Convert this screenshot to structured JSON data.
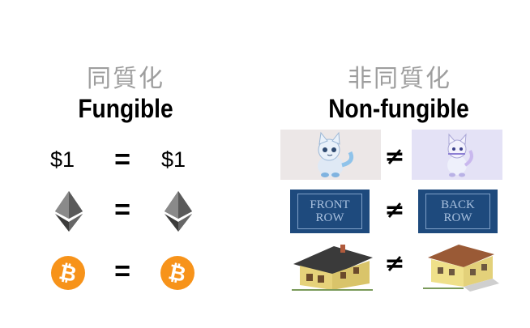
{
  "fungible": {
    "heading_cjk": "同質化",
    "title": "Fungible",
    "rows": [
      {
        "left": "$1",
        "op": "=",
        "right": "$1"
      },
      {
        "left_icon": "ethereum-icon",
        "op": "=",
        "right_icon": "ethereum-icon"
      },
      {
        "left_icon": "bitcoin-icon",
        "left_symbol": "₿",
        "op": "=",
        "right_icon": "bitcoin-icon",
        "right_symbol": "₿"
      }
    ]
  },
  "non_fungible": {
    "heading_cjk": "非同質化",
    "title": "Non-fungible",
    "rows": [
      {
        "left_icon": "cryptokitty-cat-image",
        "op": "≠",
        "right_icon": "cryptokitty-cat-image"
      },
      {
        "left_line1": "FRONT",
        "left_line2": "ROW",
        "op": "≠",
        "right_line1": "BACK",
        "right_line2": "ROW"
      },
      {
        "left_icon": "house-image",
        "op": "≠",
        "right_icon": "house-image"
      }
    ]
  },
  "colors": {
    "heading_gray": "#9e9e9e",
    "bitcoin_orange": "#f7931a",
    "ticket_blue": "#1e4a7d",
    "cat_bg_left": "#ece7e7",
    "cat_bg_right": "#e4e2f6"
  }
}
